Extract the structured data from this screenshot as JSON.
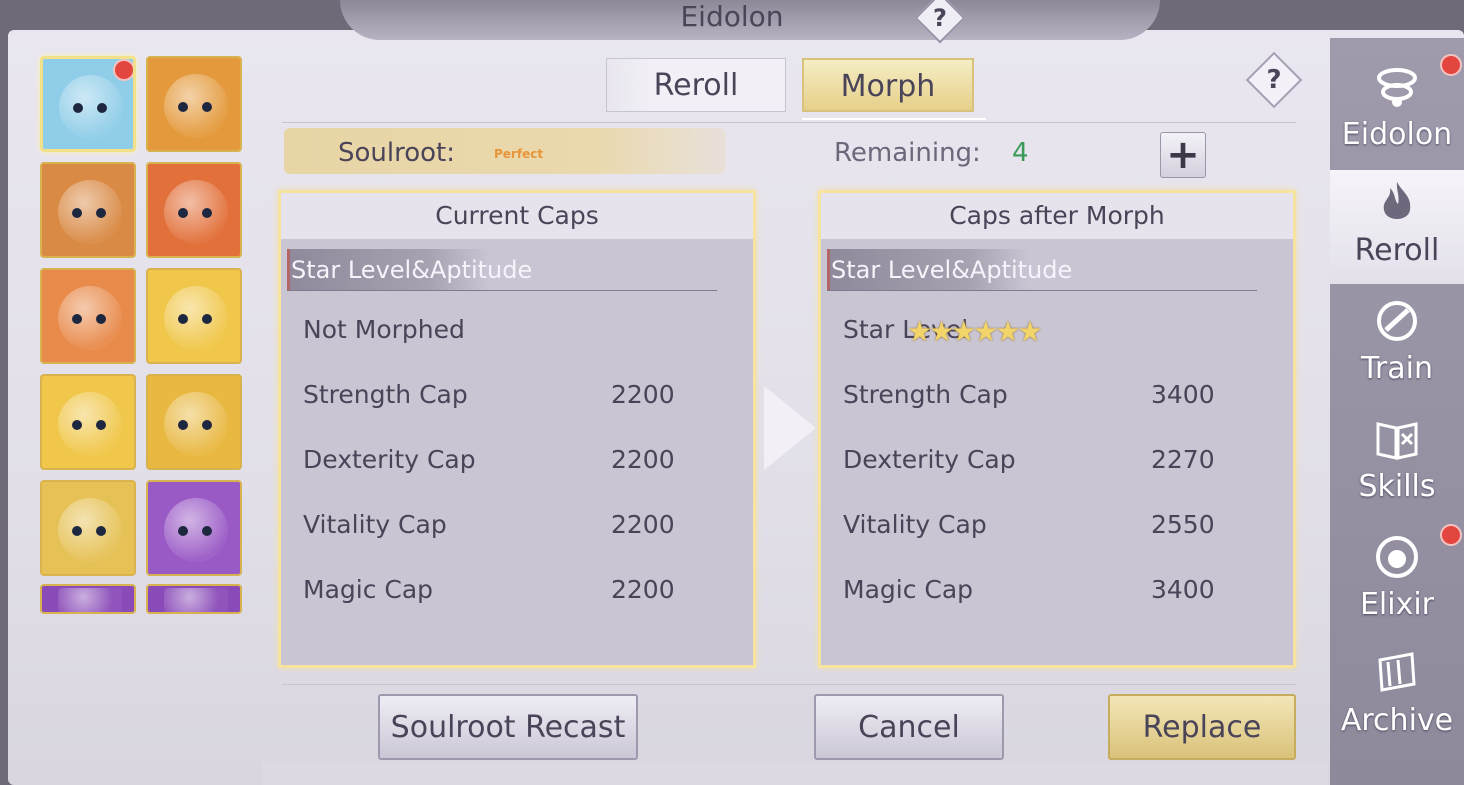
{
  "header": {
    "title": "Eidolon",
    "help_label": "?"
  },
  "tabs": [
    {
      "label": "Reroll",
      "active": false
    },
    {
      "label": "Morph",
      "active": true
    }
  ],
  "help_label": "?",
  "soulroot": {
    "label": "Soulroot:",
    "value": "Perfect"
  },
  "remaining": {
    "label": "Remaining:",
    "value": "4"
  },
  "plus_label": "+",
  "current_caps": {
    "title": "Current Caps",
    "section": "Star Level&Aptitude",
    "morph_status": "Not Morphed",
    "rows": [
      {
        "label": "Strength Cap",
        "value": "2200"
      },
      {
        "label": "Dexterity Cap",
        "value": "2200"
      },
      {
        "label": "Vitality Cap",
        "value": "2200"
      },
      {
        "label": "Magic Cap",
        "value": "2200"
      }
    ]
  },
  "morph_caps": {
    "title": "Caps after Morph",
    "section": "Star Level&Aptitude",
    "star_label": "Star Level",
    "stars": "★★★★★★",
    "star_count": 6,
    "rows": [
      {
        "label": "Strength Cap",
        "value": "3400"
      },
      {
        "label": "Dexterity Cap",
        "value": "2270"
      },
      {
        "label": "Vitality Cap",
        "value": "2550"
      },
      {
        "label": "Magic Cap",
        "value": "3400"
      }
    ]
  },
  "buttons": {
    "recast": "Soulroot Recast",
    "cancel": "Cancel",
    "replace": "Replace"
  },
  "nav": [
    {
      "label": "Eidolon",
      "icon": "collar-icon",
      "active": false,
      "badge": true
    },
    {
      "label": "Reroll",
      "icon": "flame-icon",
      "active": true,
      "badge": false
    },
    {
      "label": "Train",
      "icon": "ring-icon",
      "active": false,
      "badge": false
    },
    {
      "label": "Skills",
      "icon": "book-icon",
      "active": false,
      "badge": false
    },
    {
      "label": "Elixir",
      "icon": "orb-icon",
      "active": false,
      "badge": true
    },
    {
      "label": "Archive",
      "icon": "scroll-icon",
      "active": false,
      "badge": false
    }
  ],
  "pets": [
    {
      "icon": "blue-hair-girl-pet-icon",
      "selected": true,
      "badge": true,
      "bg": "#8fcde8"
    },
    {
      "icon": "green-dragon-pet-icon",
      "selected": false,
      "badge": false,
      "bg": "#e49a3c"
    },
    {
      "icon": "bear-warrior-pet-icon",
      "selected": false,
      "badge": false,
      "bg": "#d98a45"
    },
    {
      "icon": "fire-dragon-pet-icon",
      "selected": false,
      "badge": false,
      "bg": "#e2703a"
    },
    {
      "icon": "onion-spirit-pet-icon",
      "selected": false,
      "badge": false,
      "bg": "#e88a4a"
    },
    {
      "icon": "blue-bunny-pet-icon",
      "selected": false,
      "badge": false,
      "bg": "#f0c74a"
    },
    {
      "icon": "blue-bunny-pet-icon",
      "selected": false,
      "badge": false,
      "bg": "#f0c74a"
    },
    {
      "icon": "pumpkin-pet-icon",
      "selected": false,
      "badge": false,
      "bg": "#e8b841"
    },
    {
      "icon": "frog-cat-pet-icon",
      "selected": false,
      "badge": false,
      "bg": "#e6c155"
    },
    {
      "icon": "succulent-pet-icon",
      "selected": false,
      "badge": false,
      "bg": "#9a5ac6"
    },
    {
      "icon": "lightning-pet-icon",
      "selected": false,
      "badge": false,
      "bg": "#8a4bb8"
    },
    {
      "icon": "lightning-pet-icon",
      "selected": false,
      "badge": false,
      "bg": "#8a4bb8"
    }
  ]
}
